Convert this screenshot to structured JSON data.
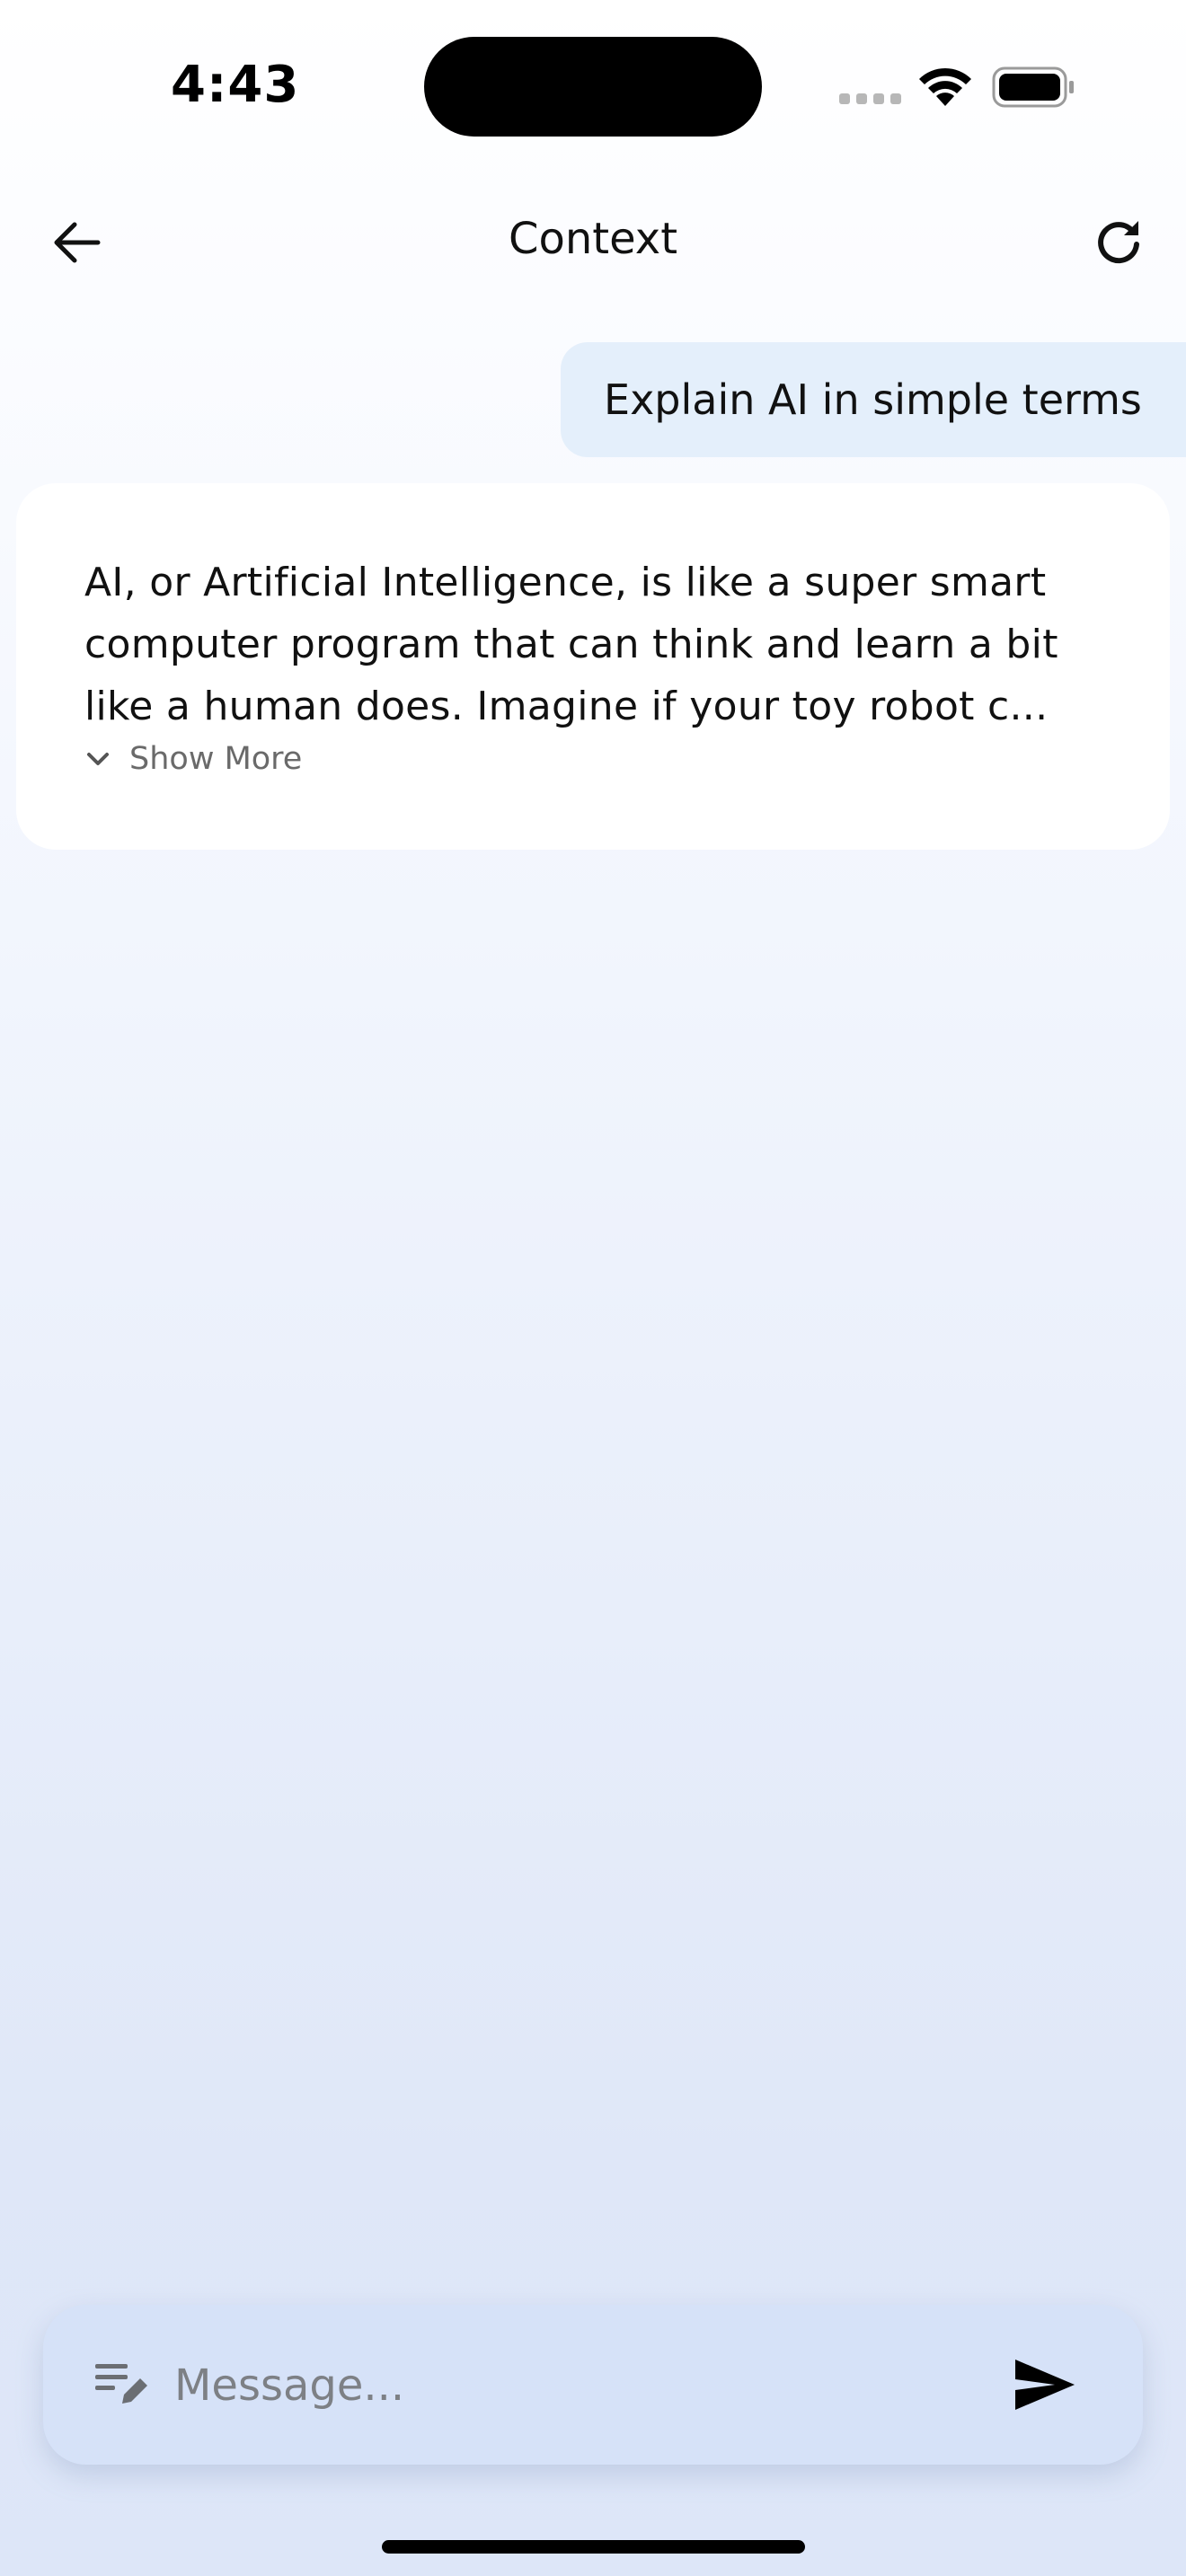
{
  "status_bar": {
    "time": "4:43"
  },
  "header": {
    "title": "Context",
    "back_icon": "arrow-left-icon",
    "refresh_icon": "refresh-icon"
  },
  "conversation": {
    "user_message": "Explain AI in simple terms",
    "ai_response_lines": [
      "AI, or Artificial Intelligence, is like a super smart",
      "computer program that can think and learn a bit",
      "like a human does. Imagine if your toy robot c..."
    ],
    "show_more_label": "Show More",
    "show_more_icon": "chevron-down-icon"
  },
  "composer": {
    "placeholder": "Message...",
    "value": "",
    "compose_icon": "compose-icon",
    "send_icon": "send-icon"
  },
  "colors": {
    "user_bubble": "#e4effb",
    "ai_card": "#ffffff",
    "composer_bg": "#d6e2f8",
    "muted_text": "#6a6a6a"
  }
}
